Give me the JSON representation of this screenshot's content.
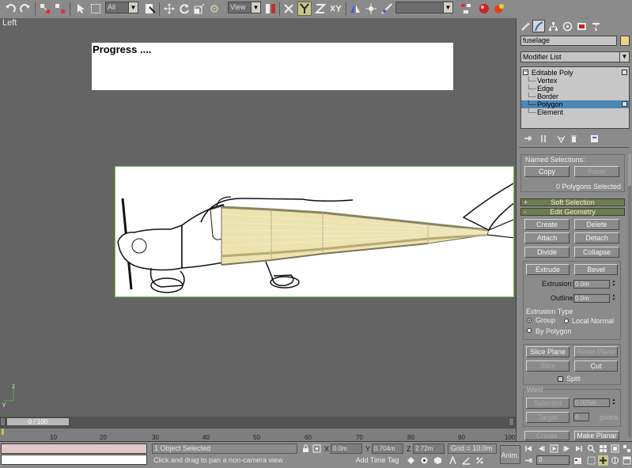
{
  "toolbar": {
    "selection_filter": "All",
    "reference_coord": "View",
    "named_selection_sets": ""
  },
  "viewport": {
    "label": "Left",
    "progress_text": "Progress ....",
    "axis_z": "z",
    "axis_y": "y"
  },
  "command_panel": {
    "object_name": "fuselage",
    "object_color": "#ecd58a",
    "modifier_list": "Modifier List",
    "stack": {
      "root": "Editable Poly",
      "items": [
        "Vertex",
        "Edge",
        "Border",
        "Polygon",
        "Element"
      ],
      "selected": "Polygon"
    },
    "selection_rollout": {
      "named_selections": "Named Selections:",
      "copy": "Copy",
      "paste": "Paste",
      "status": "0 Polygons Selected"
    },
    "soft_selection": {
      "sign": "+",
      "title": "Soft Selection"
    },
    "edit_geometry": {
      "sign": "-",
      "title": "Edit Geometry"
    },
    "buttons": {
      "create": "Create",
      "delete": "Delete",
      "attach": "Attach",
      "detach": "Detach",
      "divide": "Divide",
      "collapse": "Collapse",
      "extrude": "Extrude",
      "bevel": "Bevel",
      "slice_plane": "Slice Plane",
      "reset_plane": "Reset Plane",
      "slice": "Slice",
      "cut": "Cut",
      "selected": "Selected",
      "target": "Target",
      "create_shape": "Create Shape",
      "make_planar": "Make Planar"
    },
    "extrusion_label": "Extrusion:",
    "extrusion_value": "0.0m",
    "outline_label": "Outline:",
    "outline_value": "0.0m",
    "extrusion_type": {
      "title": "Extrusion Type",
      "group": "Group",
      "local_normal": "Local Normal",
      "by_polygon": "By Polygon",
      "selected": "Group"
    },
    "split_label": "Split",
    "weld": {
      "title": "Weld",
      "selected_value": "0.005m",
      "target_value": "4",
      "pixels": "pixels"
    }
  },
  "time_slider": {
    "position_label": "0 / 100",
    "ticks": [
      "10",
      "20",
      "30",
      "40",
      "50",
      "60",
      "70",
      "80",
      "90",
      "100"
    ]
  },
  "status_bar": {
    "selection_status": "1 Object Selected",
    "prompt": "Click and drag to pan a non-camera view",
    "x_label": "X",
    "x_value": "0.0m",
    "y_label": "Y",
    "y_value": "0.704m",
    "z_label": "Z",
    "z_value": "2.72m",
    "grid": "Grid = 10.0m",
    "add_time_tag": "Add Time Tag",
    "anim_button": "Anim.",
    "current_frame": "0"
  }
}
